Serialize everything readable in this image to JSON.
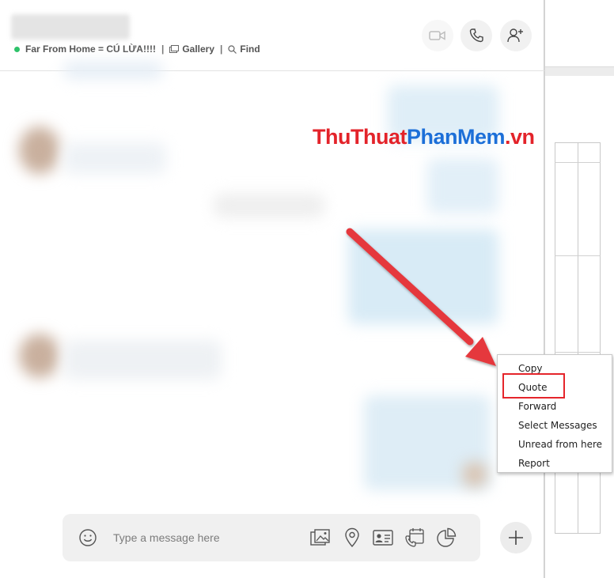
{
  "chat": {
    "status_text": "Far From Home = CÚ LỪA!!!!",
    "gallery_label": "Gallery",
    "find_label": "Find",
    "separator": "|"
  },
  "header_buttons": [
    {
      "icon": "video-call-icon",
      "disabled": true
    },
    {
      "icon": "phone-call-icon",
      "disabled": false
    },
    {
      "icon": "add-person-icon",
      "disabled": false
    }
  ],
  "watermark": {
    "part1": "ThuThuat",
    "part2": "PhanMem",
    "part3": ".vn",
    "color_red": "#e3232a",
    "color_blue": "#1c6fd8"
  },
  "composer": {
    "placeholder": "Type a message here",
    "icons": [
      "emoji-icon",
      "media-icon",
      "location-icon",
      "contact-card-icon",
      "schedule-call-icon",
      "poll-icon"
    ],
    "add_icon": "plus-icon"
  },
  "context_menu": {
    "items": [
      "Copy",
      "Quote",
      "Forward",
      "Select Messages",
      "Unread from here",
      "Report"
    ],
    "highlighted": "Quote"
  },
  "colors": {
    "online": "#2ec26a",
    "highlight": "#e5252b",
    "arrow": "#e5383d"
  }
}
